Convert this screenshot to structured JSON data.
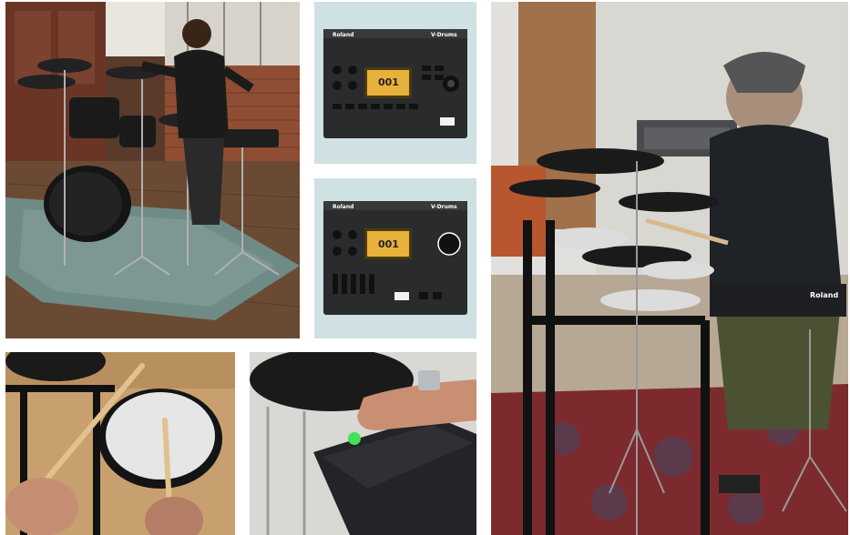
{
  "colors": {
    "tile_bg_mint": "#cfe1e2",
    "module_body": "#2a2b2d",
    "screen_yellow": "#e8b23a",
    "brick": "#8f4e34",
    "floor_wood": "#6b4a34",
    "rug_red": "#7d2a2e",
    "rug_teal": "#6f8b86",
    "led_green": "#43e05a"
  },
  "module_top": {
    "brand": "Roland",
    "series": "V-Drums",
    "screen_number": "001"
  },
  "module_bottom": {
    "brand": "Roland",
    "series": "V-Drums",
    "screen_number": "001"
  },
  "right_photo": {
    "brand_on_module": "Roland"
  },
  "icons": [
    "drum-kit-photo",
    "sound-module",
    "drum-pad",
    "cymbal"
  ]
}
